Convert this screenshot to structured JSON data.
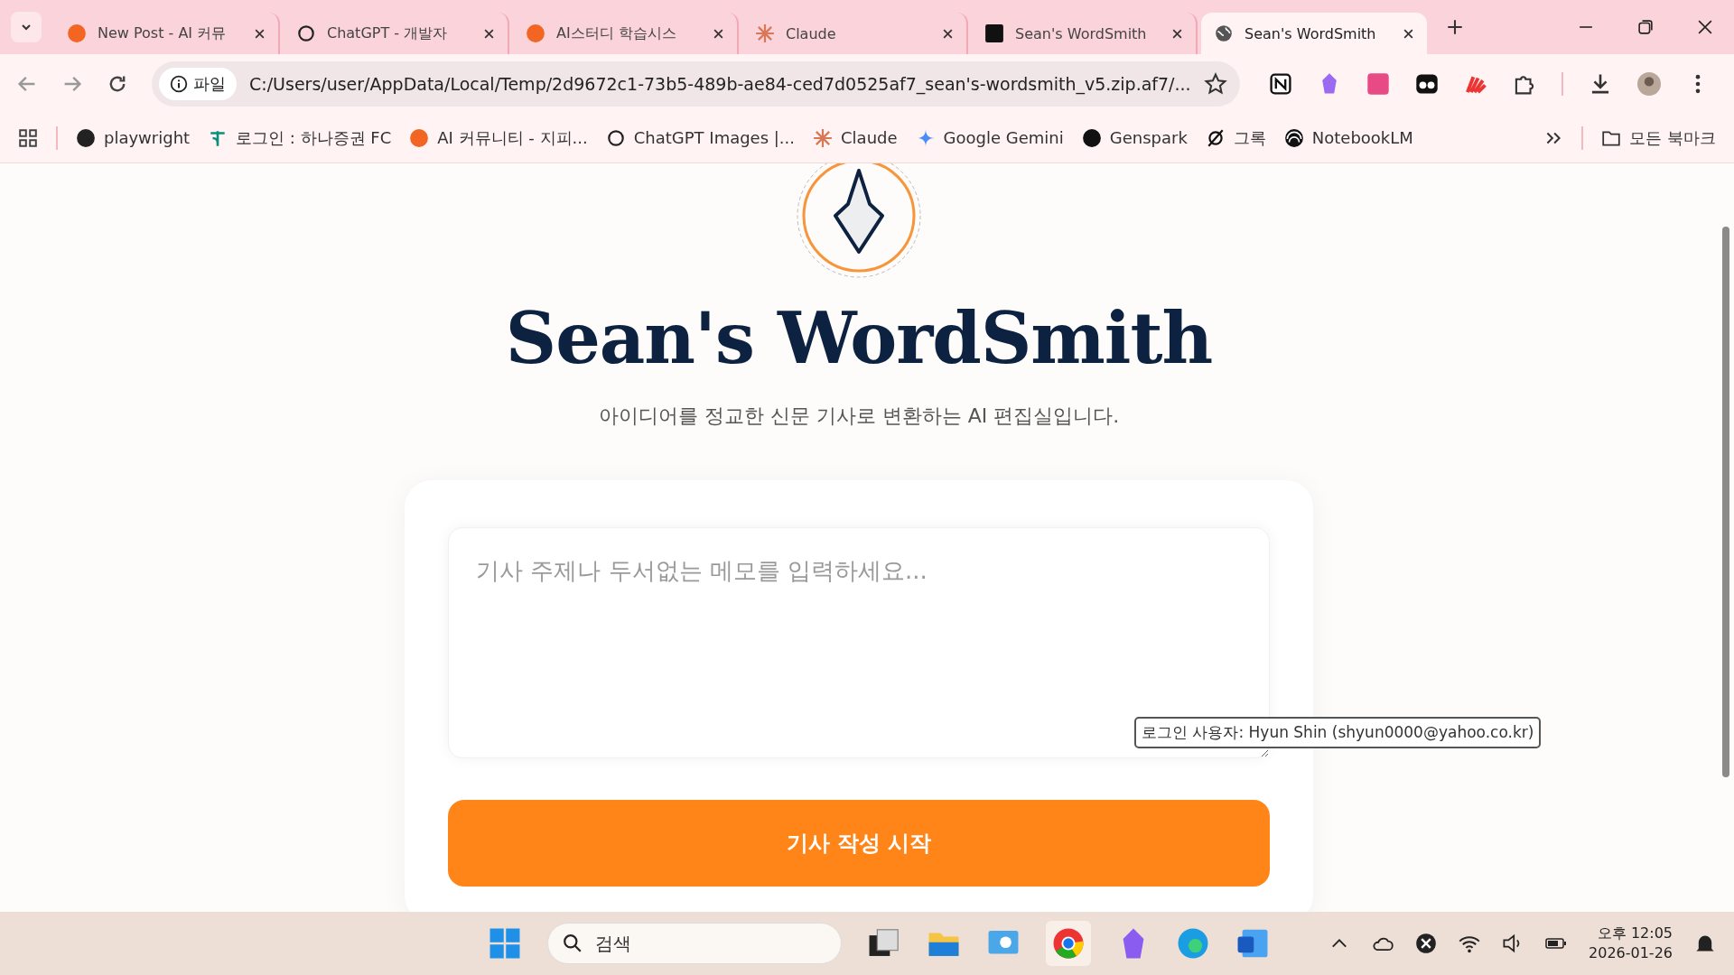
{
  "tabs": [
    {
      "title": "New Post - AI 커뮤",
      "kind": "orange",
      "selected": false
    },
    {
      "title": "ChatGPT - 개발자",
      "kind": "knot",
      "selected": false
    },
    {
      "title": "AI스터디 학습시스",
      "kind": "orange",
      "selected": false
    },
    {
      "title": "Claude",
      "kind": "burst",
      "selected": false
    },
    {
      "title": "Sean's WordSmith",
      "kind": "spark",
      "selected": false
    },
    {
      "title": "Sean's WordSmith",
      "kind": "globe",
      "selected": true
    }
  ],
  "address": {
    "scheme": "파일",
    "url": "C:/Users/user/AppData/Local/Temp/2d9672c1-73b5-489b-ae84-ced7d0525af7_sean's-wordsmith_v5.zip.af7/..."
  },
  "bookmarks": [
    {
      "label": "playwright",
      "kind": "github"
    },
    {
      "label": "로그인 : 하나증권 FC",
      "kind": "leaf"
    },
    {
      "label": "AI 커뮤니티 - 지피...",
      "kind": "orange"
    },
    {
      "label": "ChatGPT Images |...",
      "kind": "knot"
    },
    {
      "label": "Claude",
      "kind": "burst"
    },
    {
      "label": "Google Gemini",
      "kind": "star"
    },
    {
      "label": "Genspark",
      "kind": "face"
    },
    {
      "label": "그록",
      "kind": "slash"
    },
    {
      "label": "NotebookLM",
      "kind": "rings"
    }
  ],
  "all_bookmarks": "모든 북마크",
  "page": {
    "title": "Sean's WordSmith",
    "subtitle": "아이디어를 정교한 신문 기사로 변환하는 AI 편집실입니다.",
    "input": {
      "placeholder": "기사 주제나 두서없는 메모를 입력하세요..."
    },
    "button": "기사 작성 시작",
    "tooltip": "로그인 사용자: Hyun Shin (shyun0000@yahoo.co.kr)"
  },
  "taskbar": {
    "search": {
      "placeholder": "검색"
    },
    "time": "오후 12:05",
    "date": "2026-01-26"
  }
}
